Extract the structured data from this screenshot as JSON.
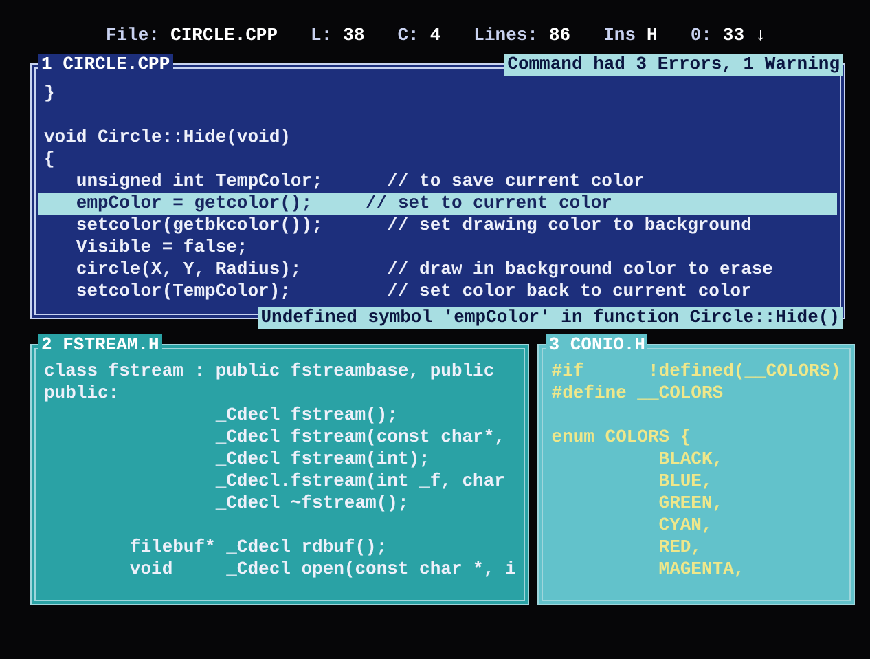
{
  "status_bar": [
    {
      "label": "File:",
      "value": "CIRCLE.CPP"
    },
    {
      "label": "L:",
      "value": "38"
    },
    {
      "label": "C:",
      "value": "4"
    },
    {
      "label": "Lines:",
      "value": "86"
    },
    {
      "label": "Ins",
      "value": "H"
    },
    {
      "label": "0:",
      "value": "33 ↓"
    }
  ],
  "windows": [
    {
      "title": "1 CIRCLE.CPP",
      "active": true,
      "color": "#1d2f7c",
      "message": "Command had 3 Errors, 1 Warning",
      "error": "Undefined symbol 'empColor' in function Circle::Hide()",
      "lines": [
        {
          "kind": "code",
          "text": "}",
          "selected": false
        },
        {
          "kind": "blank"
        },
        {
          "kind": "code",
          "text": "void Circle::Hide(void)",
          "selected": false
        },
        {
          "kind": "code",
          "text": "{",
          "selected": false
        },
        {
          "kind": "code",
          "text": "   unsigned int TempColor;      // to save current color",
          "selected": false
        },
        {
          "kind": "code",
          "text": "   empColor = getcolor();     // set to current color",
          "selected": true
        },
        {
          "kind": "code",
          "text": "   setcolor(getbkcolor());      // set drawing color to background",
          "selected": false
        },
        {
          "kind": "code",
          "text": "   Visible = false;",
          "selected": false
        },
        {
          "kind": "code",
          "text": "   circle(X, Y, Radius);        // draw in background color to erase",
          "selected": false
        },
        {
          "kind": "code",
          "text": "   setcolor(TempColor);         // set color back to current color",
          "selected": false
        }
      ]
    },
    {
      "title": "2 FSTREAM.H",
      "active": false,
      "color": "#2aa2a5",
      "lines": [
        {
          "kind": "code",
          "text": "class fstream : public fstreambase, public",
          "selected": false
        },
        {
          "kind": "code",
          "text": "public:",
          "selected": false
        },
        {
          "kind": "code",
          "text": "                _Cdecl fstream();",
          "selected": false
        },
        {
          "kind": "code",
          "text": "                _Cdecl fstream(const char*,",
          "selected": false
        },
        {
          "kind": "code",
          "text": "                _Cdecl fstream(int);",
          "selected": false
        },
        {
          "kind": "code",
          "text": "                _Cdecl.fstream(int _f, char",
          "selected": false
        },
        {
          "kind": "code",
          "text": "                _Cdecl ~fstream();",
          "selected": false
        },
        {
          "kind": "blank"
        },
        {
          "kind": "code",
          "text": "        filebuf* _Cdecl rdbuf();",
          "selected": false
        },
        {
          "kind": "code",
          "text": "        void     _Cdecl open(const char *, i",
          "selected": false
        }
      ]
    },
    {
      "title": "3 CONIO.H",
      "active": false,
      "color": "#62c2cb",
      "lines": [
        {
          "kind": "code",
          "text": "#if      !defined(__COLORS)",
          "selected": false
        },
        {
          "kind": "code",
          "text": "#define __COLORS",
          "selected": false
        },
        {
          "kind": "blank"
        },
        {
          "kind": "code",
          "text": "enum COLORS {",
          "selected": false
        },
        {
          "kind": "code",
          "text": "          BLACK,",
          "selected": false
        },
        {
          "kind": "code",
          "text": "          BLUE,",
          "selected": false
        },
        {
          "kind": "code",
          "text": "          GREEN,",
          "selected": false
        },
        {
          "kind": "code",
          "text": "          CYAN,",
          "selected": false
        },
        {
          "kind": "code",
          "text": "          RED,",
          "selected": false
        },
        {
          "kind": "code",
          "text": "          MAGENTA,",
          "selected": false
        }
      ]
    }
  ]
}
